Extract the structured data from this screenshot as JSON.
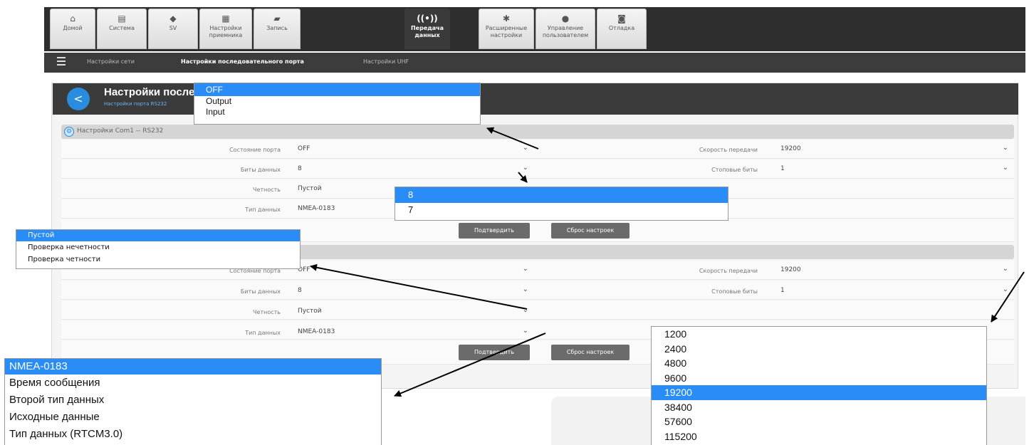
{
  "nav": {
    "tabs": [
      {
        "label": "Домой",
        "icon": "home-icon",
        "glyph": "⌂"
      },
      {
        "label": "Система",
        "icon": "system-icon",
        "glyph": "▤"
      },
      {
        "label": "SV",
        "icon": "sv-icon",
        "glyph": "◆"
      },
      {
        "label": "Настройки приемника",
        "icon": "receiver-icon",
        "glyph": "▦"
      },
      {
        "label": "Запись",
        "icon": "folder-icon",
        "glyph": "▰"
      },
      {
        "label": "Передача данных",
        "icon": "transfer-icon",
        "glyph": "((•))"
      },
      {
        "label": "Расширенные настройки",
        "icon": "gear-icon",
        "glyph": "✱"
      },
      {
        "label": "Управление пользователем",
        "icon": "user-icon",
        "glyph": "●"
      },
      {
        "label": "Отладка",
        "icon": "camera-icon",
        "glyph": "◙"
      }
    ],
    "active_tab": "Передача данных"
  },
  "subnav": {
    "items": [
      "Настройки сети",
      "Настройки последовательного порта",
      "Настройки UHF"
    ],
    "active": "Настройки последовательного порта"
  },
  "panel": {
    "title": "Настройки последовательного порта",
    "subtitle": "Настройки порта RS232"
  },
  "sections": [
    {
      "title": "Настройки Com1 -- RS232",
      "fields": {
        "port_state": {
          "label": "Состояние порта",
          "value": "OFF"
        },
        "data_bits": {
          "label": "Биты данных",
          "value": "8"
        },
        "parity": {
          "label": "Четность",
          "value": "Пустой"
        },
        "data_type": {
          "label": "Тип данных",
          "value": "NMEA-0183"
        },
        "baud_rate": {
          "label": "Скорость передачи",
          "value": "19200"
        },
        "stop_bits": {
          "label": "Стоповые биты",
          "value": "1"
        }
      },
      "confirm_label": "Подтвердить",
      "reset_label": "Сброс настроек"
    },
    {
      "title": "",
      "fields": {
        "port_state": {
          "label": "Состояние порта",
          "value": "OFF"
        },
        "data_bits": {
          "label": "Биты данных",
          "value": "8"
        },
        "parity": {
          "label": "Четность",
          "value": "Пустой"
        },
        "data_type": {
          "label": "Тип данных",
          "value": "NMEA-0183"
        },
        "baud_rate": {
          "label": "Скорость передачи",
          "value": "19200"
        },
        "stop_bits": {
          "label": "Стоповые биты",
          "value": "1"
        }
      },
      "confirm_label": "Подтвердить",
      "reset_label": "Сброс настроек"
    }
  ],
  "popups": {
    "port_state_options": [
      "OFF",
      "Output",
      "Input"
    ],
    "port_state_selected": "OFF",
    "data_bits_options": [
      "8",
      "7"
    ],
    "data_bits_selected": "8",
    "parity_options": [
      "Пустой",
      "Проверка нечетности",
      "Проверка четности"
    ],
    "parity_selected": "Пустой",
    "data_type_options": [
      "NMEA-0183",
      "Время сообщения",
      "Второй тип данных",
      "Исходные данные",
      "Тип данных (RTCM3.0)"
    ],
    "data_type_selected": "NMEA-0183",
    "baud_options": [
      "1200",
      "2400",
      "4800",
      "9600",
      "19200",
      "38400",
      "57600",
      "115200"
    ],
    "baud_selected": "19200"
  },
  "colors": {
    "accent": "#2a8cf7",
    "header_dark": "#3b3b3b",
    "button_gray": "#6b6b6b"
  }
}
